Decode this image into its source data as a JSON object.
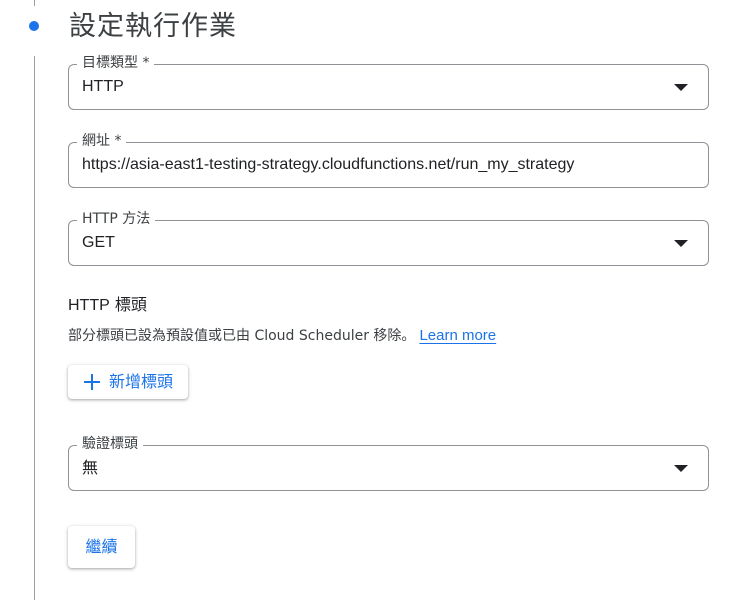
{
  "step": {
    "title": "設定執行作業"
  },
  "fields": {
    "target_type": {
      "label": "目標類型 *",
      "value": "HTTP"
    },
    "url": {
      "label": "網址 *",
      "value": "https://asia-east1-testing-strategy.cloudfunctions.net/run_my_strategy"
    },
    "http_method": {
      "label": "HTTP 方法",
      "value": "GET"
    },
    "auth_header": {
      "label": "驗證標頭",
      "value": "無"
    }
  },
  "headers_section": {
    "title_latin": "HTTP",
    "title_cjk": "標頭",
    "helper_text": "部分標頭已設為預設值或已由 Cloud Scheduler 移除。",
    "learn_more": "Learn more",
    "add_button": "新增標頭"
  },
  "actions": {
    "continue_label": "繼續"
  },
  "colors": {
    "accent": "#1a73e8",
    "border": "#8f9296",
    "text": "#202124"
  },
  "icons": {
    "step_marker": "dot-icon",
    "add": "plus-icon",
    "dropdown": "caret-down-icon"
  }
}
